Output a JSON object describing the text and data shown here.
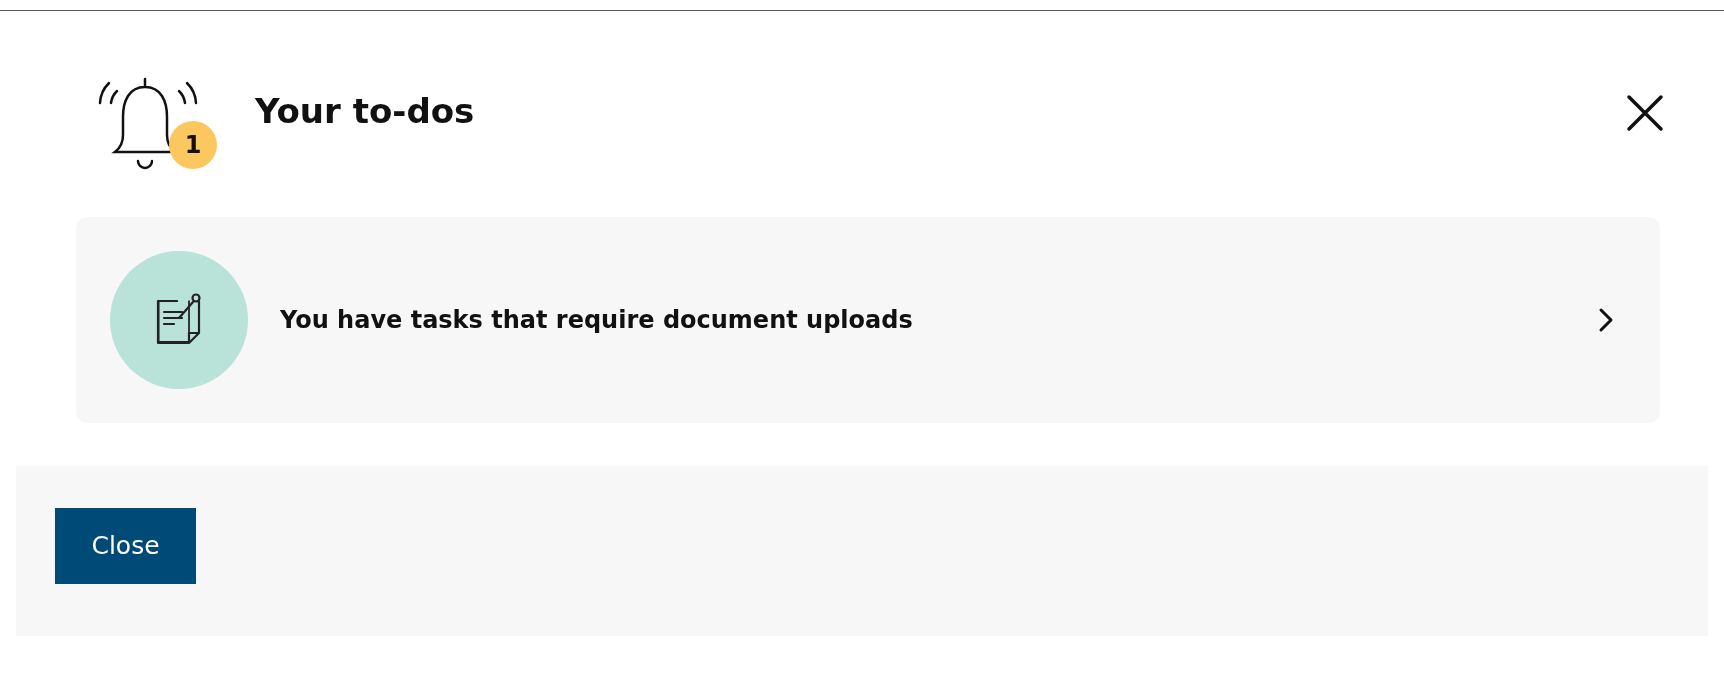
{
  "header": {
    "title": "Your to-dos",
    "badge_count": "1"
  },
  "tasks": [
    {
      "text": "You have tasks that require document uploads"
    }
  ],
  "footer": {
    "close_button": "Close"
  }
}
